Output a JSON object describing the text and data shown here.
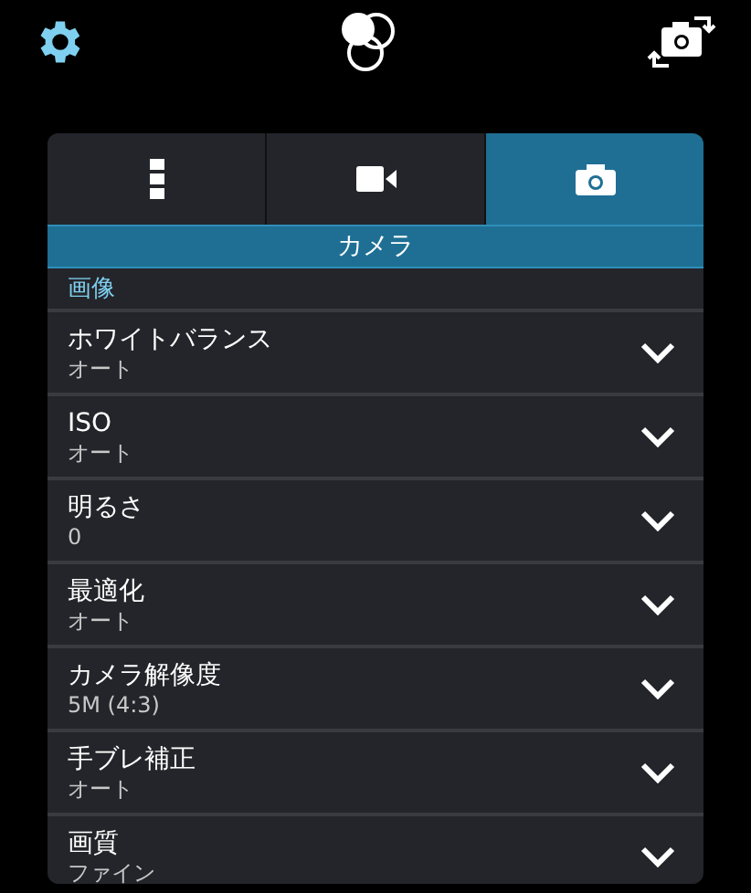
{
  "tabs": [
    {
      "kind": "more",
      "selected": false
    },
    {
      "kind": "video",
      "selected": false
    },
    {
      "kind": "photo",
      "selected": true
    }
  ],
  "header": "カメラ",
  "section": "画像",
  "settings": [
    {
      "label": "ホワイトバランス",
      "value": "オート"
    },
    {
      "label": "ISO",
      "value": "オート"
    },
    {
      "label": "明るさ",
      "value": "0"
    },
    {
      "label": "最適化",
      "value": "オート"
    },
    {
      "label": "カメラ解像度",
      "value": "5M (4:3)"
    },
    {
      "label": "手ブレ補正",
      "value": "オート"
    },
    {
      "label": "画質",
      "value": "ファイン"
    }
  ]
}
